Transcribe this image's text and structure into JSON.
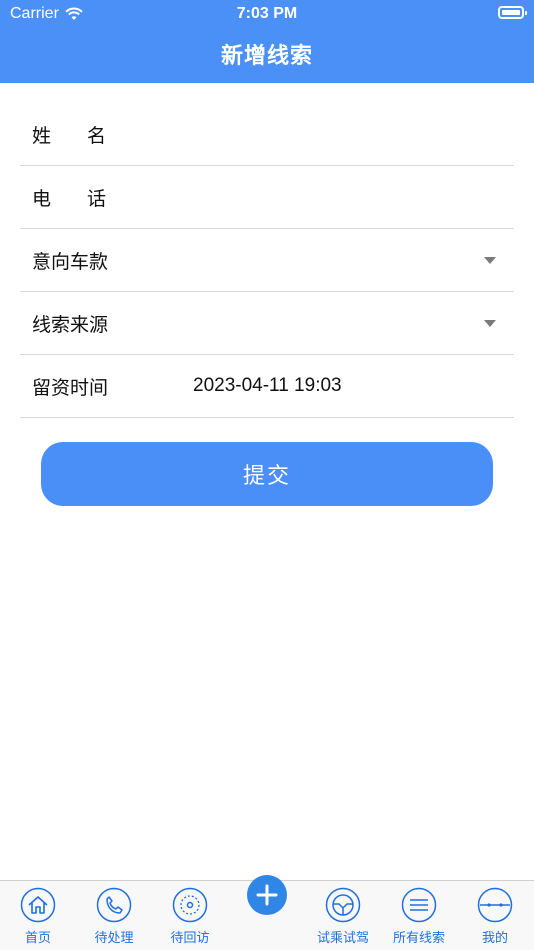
{
  "status_bar": {
    "carrier": "Carrier",
    "time": "7:03 PM"
  },
  "nav": {
    "title": "新增线索"
  },
  "form": {
    "name_label_a": "姓",
    "name_label_b": "名",
    "phone_label_a": "电",
    "phone_label_b": "话",
    "car_model_label": "意向车款",
    "lead_source_label": "线索来源",
    "time_label": "留资时间",
    "time_value": "2023-04-11 19:03"
  },
  "submit_label": "提交",
  "tabs": [
    {
      "label": "首页",
      "icon": "home-icon"
    },
    {
      "label": "待处理",
      "icon": "phone-icon"
    },
    {
      "label": "待回访",
      "icon": "revisit-icon"
    },
    {
      "label": "",
      "icon": "plus-icon"
    },
    {
      "label": "试乘试驾",
      "icon": "steering-wheel-icon"
    },
    {
      "label": "所有线索",
      "icon": "list-icon"
    },
    {
      "label": "我的",
      "icon": "profile-icon"
    }
  ],
  "colors": {
    "primary": "#4a90f7",
    "tab_text": "#1f6fe0"
  }
}
